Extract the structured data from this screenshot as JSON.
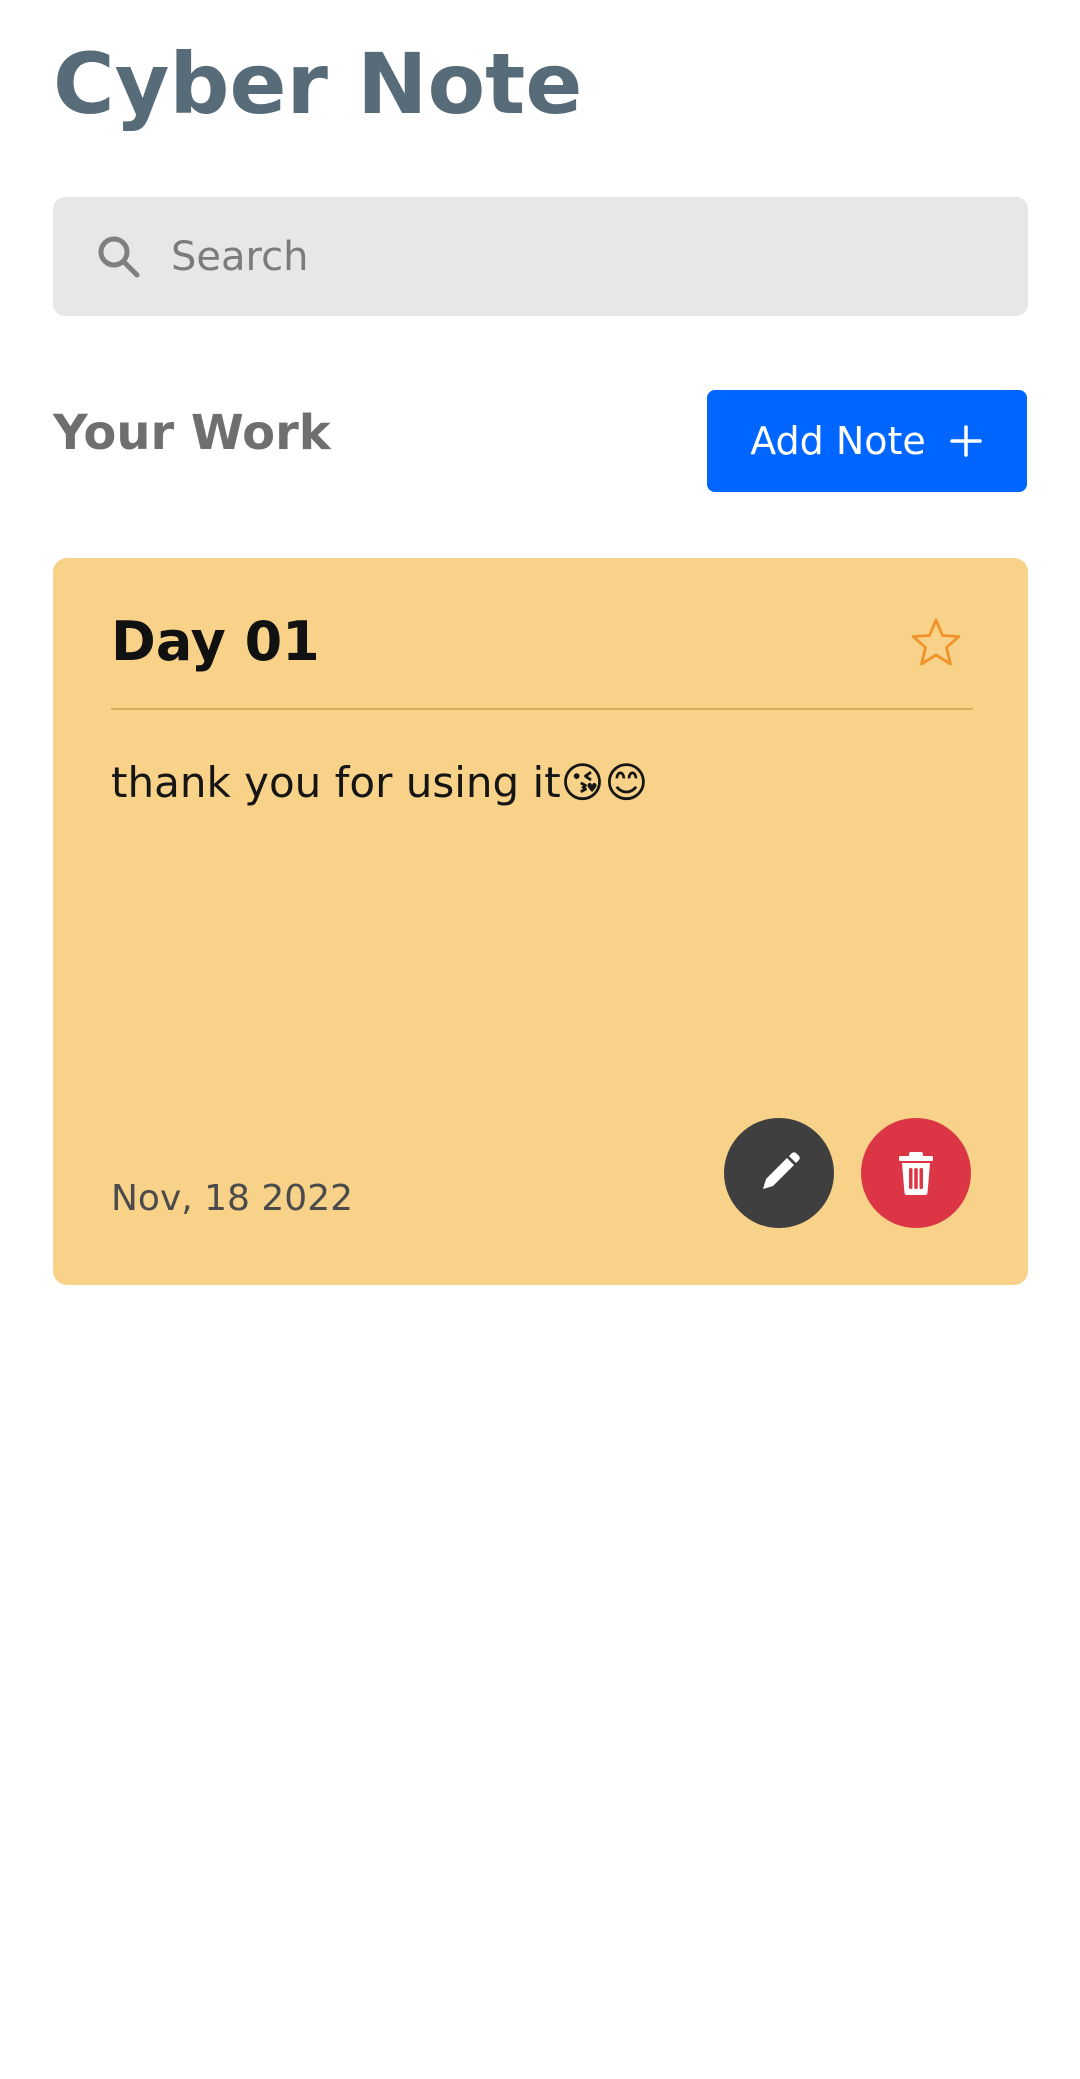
{
  "app": {
    "title": "Cyber Note"
  },
  "search": {
    "placeholder": "Search",
    "icon": "search-icon"
  },
  "section": {
    "heading": "Your Work",
    "add_note_label": "Add Note",
    "add_icon": "plus-icon"
  },
  "notes": [
    {
      "title": "Day 01",
      "body": "thank you for using it😘😊",
      "date": "Nov, 18 2022",
      "starred": false,
      "background_color": "#f7d288",
      "icons": {
        "favorite": "star-icon",
        "edit": "pencil-icon",
        "delete": "trash-icon"
      }
    }
  ],
  "colors": {
    "title": "#576b79",
    "primary_button": "#0066ff",
    "edit_button": "#3f3f3f",
    "delete_button": "#dc3545",
    "star": "#f0932b"
  }
}
